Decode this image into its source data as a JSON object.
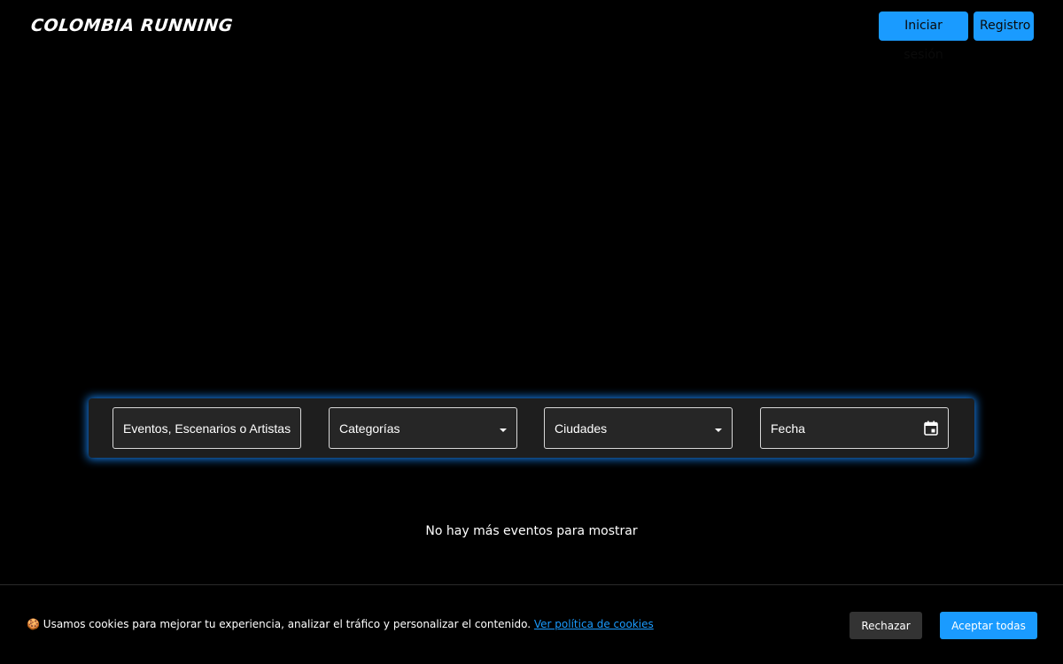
{
  "header": {
    "logo": "COLOMBIA RUNNING",
    "login_label": "Iniciar sesión",
    "register_label": "Registro"
  },
  "search": {
    "query_placeholder": "Eventos, Escenarios o Artistas",
    "categories_label": "Categorías",
    "cities_label": "Ciudades",
    "date_label": "Fecha"
  },
  "main": {
    "empty_message": "No hay más eventos para mostrar"
  },
  "cookies": {
    "icon": "🍪",
    "message": "Usamos cookies para mejorar tu experiencia, analizar el tráfico y personalizar el contenido.",
    "policy_link": "Ver política de cookies",
    "reject_label": "Rechazar",
    "accept_label": "Aceptar todas"
  },
  "colors": {
    "accent": "#1a9bff",
    "background": "#000000",
    "panel": "#1e1e1e"
  }
}
